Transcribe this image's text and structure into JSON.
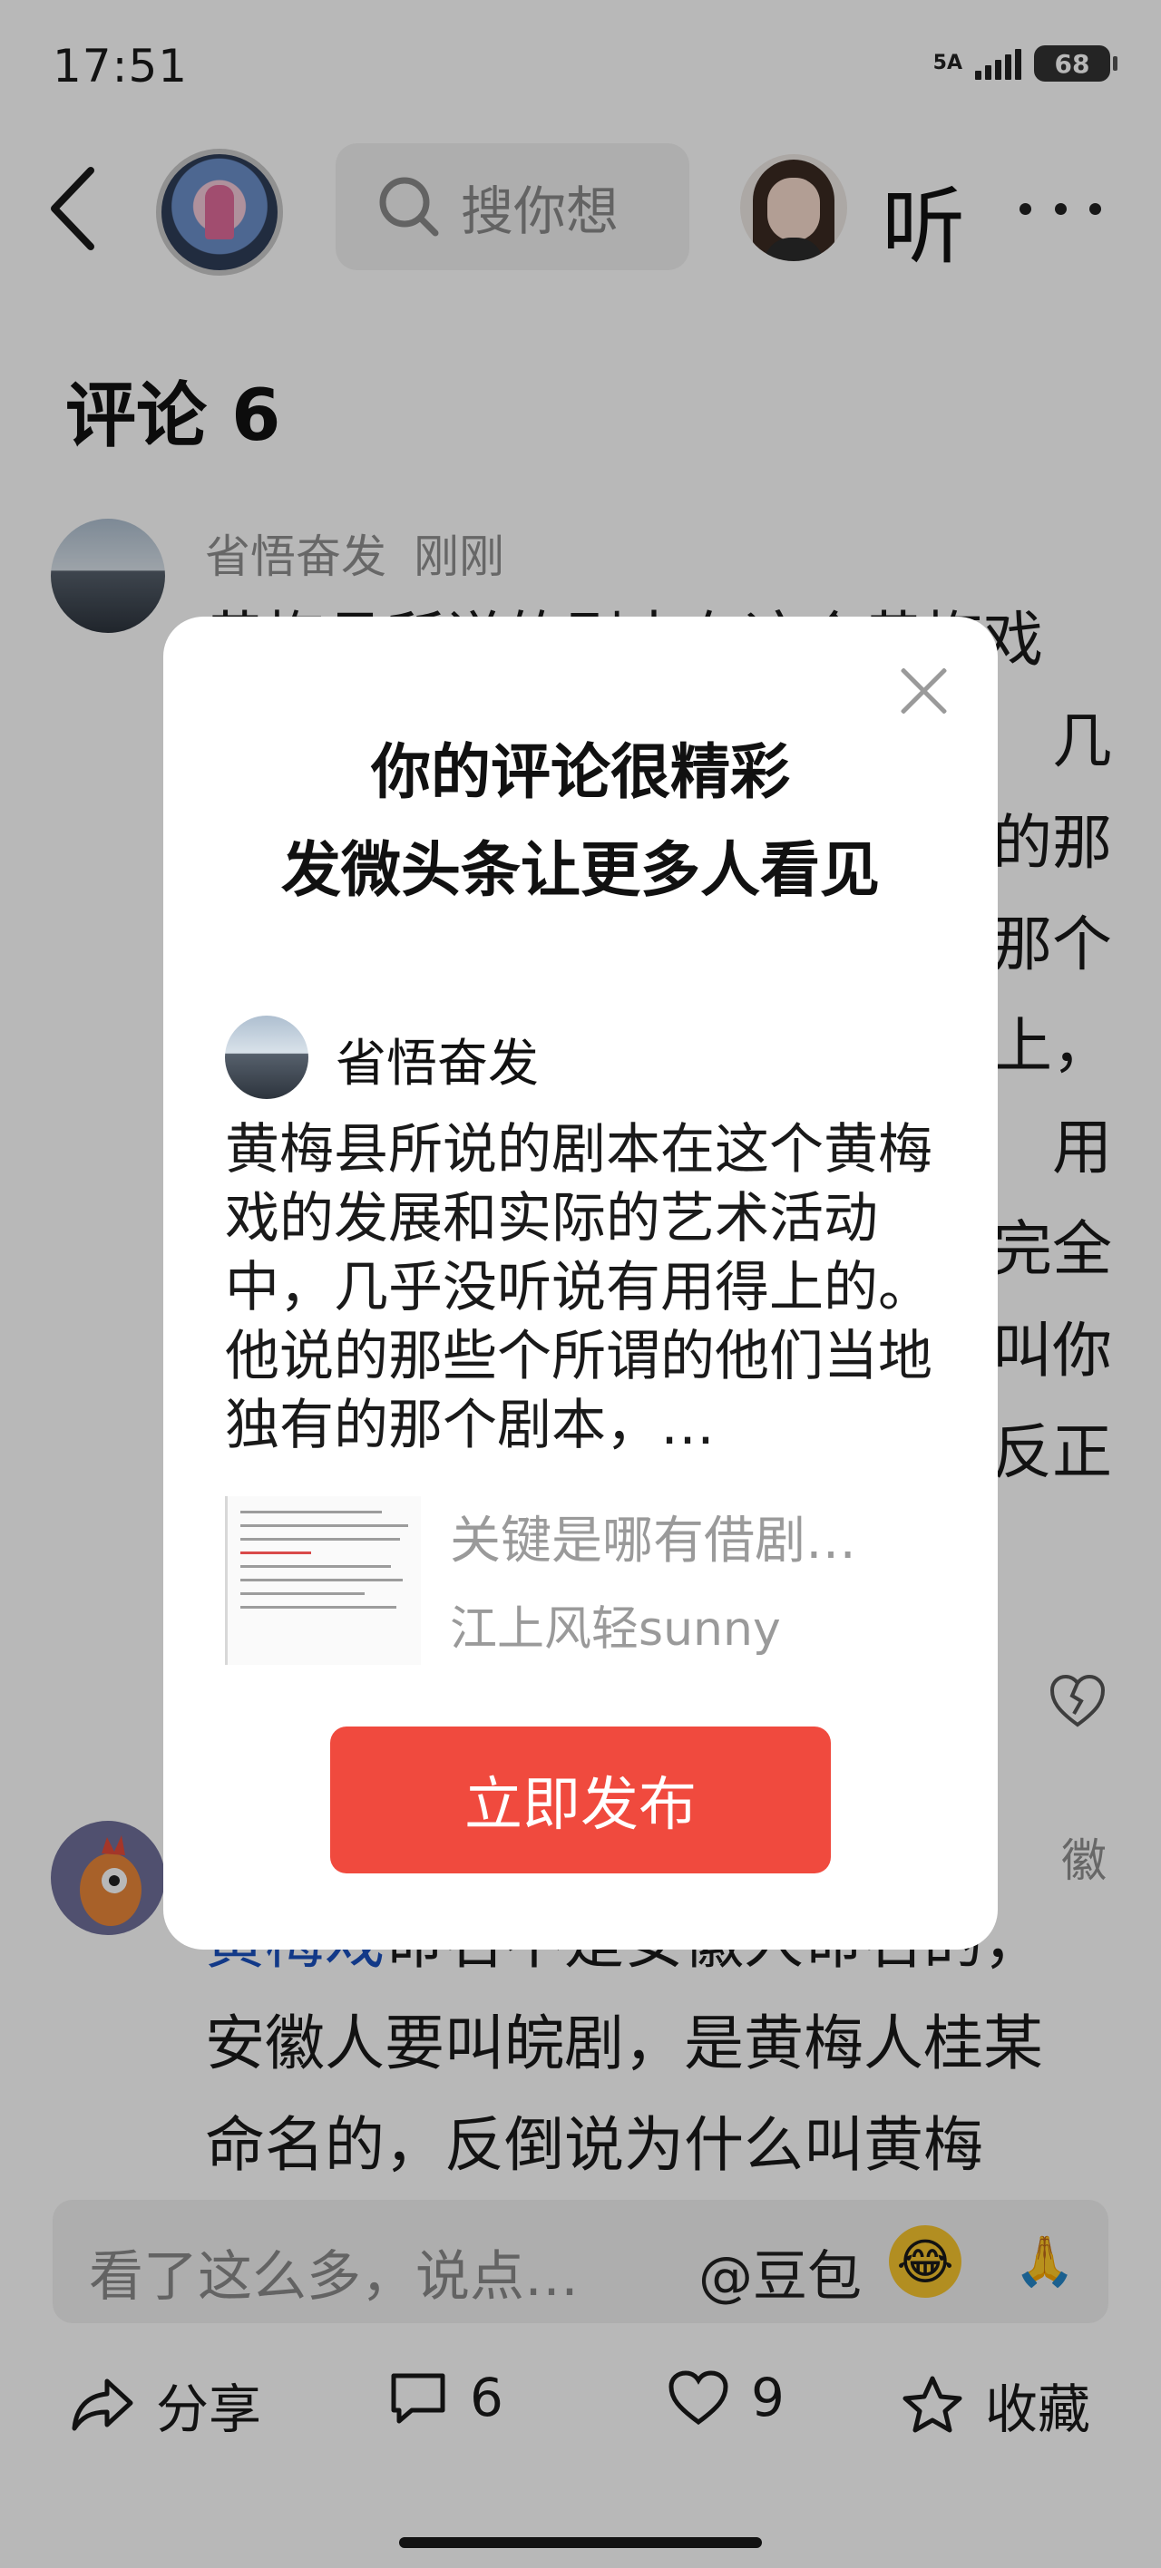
{
  "status_bar": {
    "time": "17:51",
    "network": "5A",
    "battery": "68"
  },
  "header": {
    "search_placeholder": "搜你想",
    "listen_label": "听"
  },
  "comments": {
    "title": "评论 6",
    "items": [
      {
        "author": "省悟奋发",
        "time": "刚刚",
        "visible_lines": [
          "黄梅县所说的剧本在这个黄梅戏",
          "几",
          "的那",
          "那个",
          "上，",
          "用",
          "完全",
          "叫你",
          "反正"
        ]
      },
      {
        "location": "徽",
        "body_highlight": "黄梅戏",
        "body_rest": "命名不是安徽人命名的，",
        "body_lines": [
          "安徽人要叫皖剧，是黄梅人桂某",
          "命名的，反倒说为什么叫黄梅"
        ]
      }
    ]
  },
  "input_bar": {
    "placeholder": "看了这么多，说点…",
    "mention": "@豆包",
    "emoji_laugh": "😂",
    "emoji_pray": "🙏"
  },
  "action_bar": {
    "share_label": "分享",
    "comment_count": "6",
    "like_count": "9",
    "collect_label": "收藏"
  },
  "modal": {
    "title_line1": "你的评论很精彩",
    "title_line2": "发微头条让更多人看见",
    "author": "省悟奋发",
    "quote": "黄梅县所说的剧本在这个黄梅戏的发展和实际的艺术活动中，几乎没听说有用得上的。他说的那些个所谓的他们当地独有的那个剧本，…",
    "ref_title": "关键是哪有借剧…",
    "ref_author": "江上风轻sunny",
    "publish_label": "立即发布"
  },
  "colors": {
    "publish_button": "#f04a3e",
    "highlight_link": "#1a4fbd",
    "overlay": "rgba(0,0,0,0.28)"
  }
}
